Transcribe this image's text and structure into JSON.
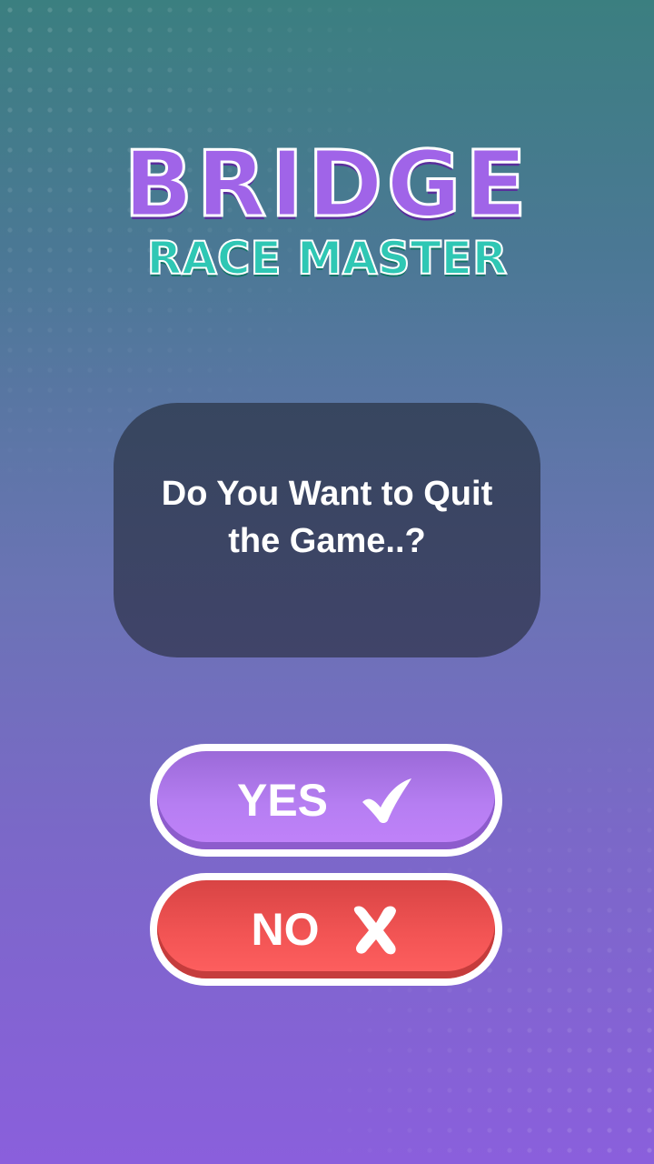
{
  "logo": {
    "line1": "BRIDGE",
    "line2": "RACE MASTER"
  },
  "dialog": {
    "message": "Do You Want to Quit the Game..?"
  },
  "buttons": {
    "yes": {
      "label": "YES",
      "icon": "check-icon"
    },
    "no": {
      "label": "NO",
      "icon": "x-icon"
    }
  },
  "colors": {
    "yes_button": "#b67ef2",
    "no_button": "#f25454",
    "dialog": "#3c4564",
    "logo_primary": "#a064e8",
    "logo_secondary": "#2fc7b4"
  }
}
